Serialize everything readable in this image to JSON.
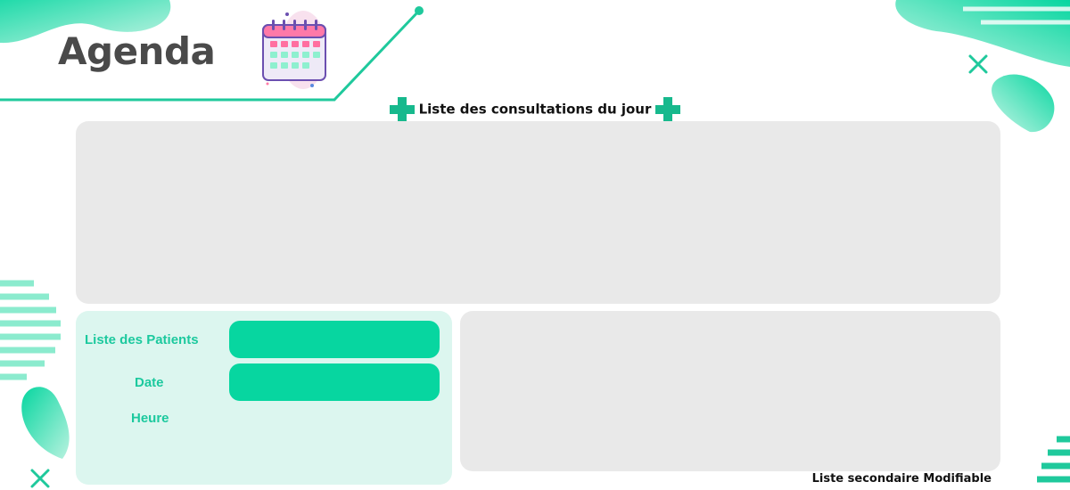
{
  "header": {
    "title": "Agenda",
    "calendar_icon": "calendar-icon"
  },
  "section": {
    "title": "Liste des consultations du jour",
    "icon": "medical-cross-icon"
  },
  "form": {
    "patients_label": "Liste des Patients",
    "patients_value": "",
    "date_label": "Date",
    "date_value": "",
    "time_label": "Heure"
  },
  "secondary": {
    "label": "Liste secondaire Modifiable"
  },
  "colors": {
    "accent": "#07d6a0",
    "accent_text": "#1cc99e",
    "panel_gray": "#e9e9e9",
    "panel_mint": "#dcf6ef",
    "title_gray": "#4a4a4a"
  }
}
